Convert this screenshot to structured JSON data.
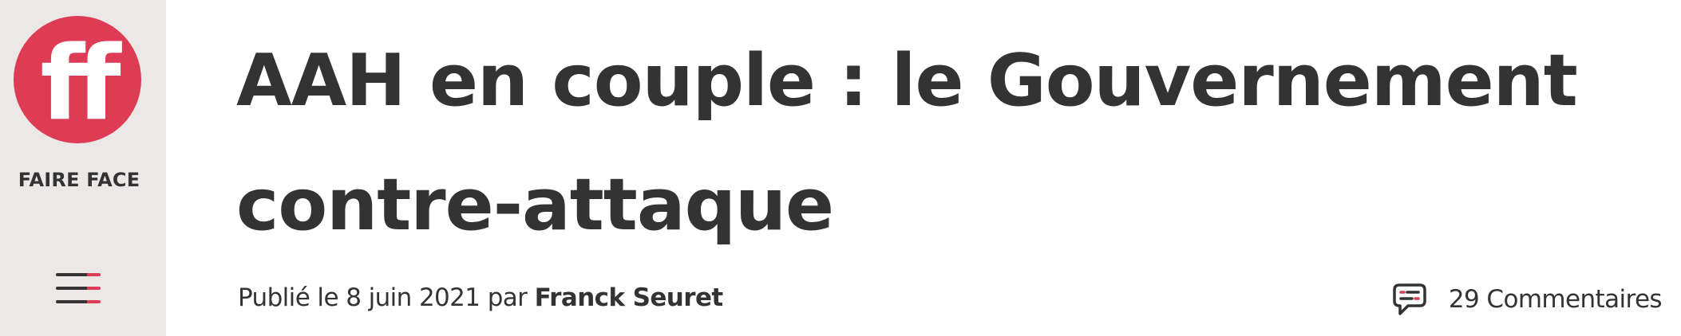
{
  "brand": {
    "logo_icon": "ff-logo-icon",
    "logo_text": "ff",
    "name": "FAIRE FACE",
    "accent_color": "#de3b55"
  },
  "menu": {
    "icon": "hamburger-menu-icon"
  },
  "article": {
    "title": "AAH en couple : le Gouvernement contre-attaque",
    "published_prefix": "Publié le",
    "date": "8 juin 2021",
    "author_prefix": "par",
    "author": "Franck Seuret"
  },
  "comments": {
    "icon": "comment-bubble-icon",
    "label": "29 Commentaires"
  }
}
